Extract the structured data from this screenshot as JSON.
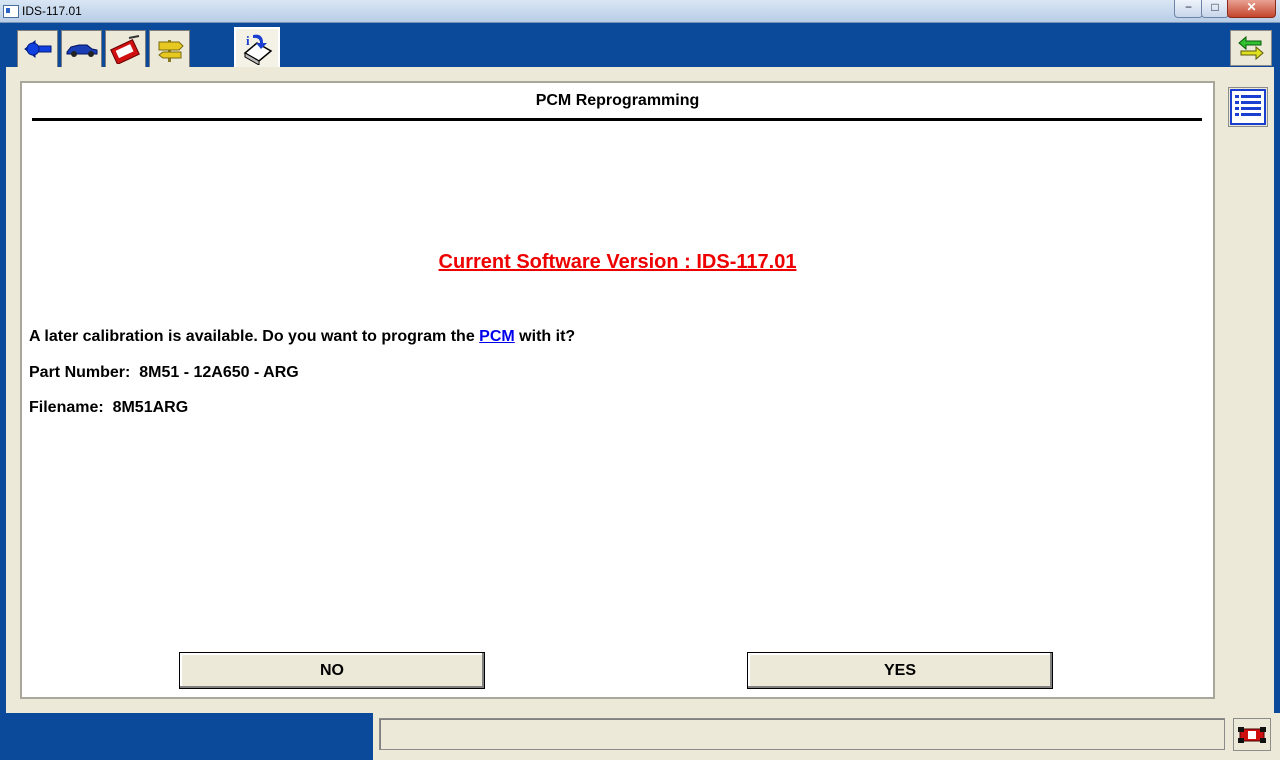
{
  "window": {
    "title": "IDS-117.01",
    "minimize_glyph": "−",
    "maximize_glyph": "□",
    "close_glyph": "✕"
  },
  "toolbar": {
    "tabs": [
      {
        "icon": "connector-icon"
      },
      {
        "icon": "vehicle-icon"
      },
      {
        "icon": "toolbox-icon"
      },
      {
        "icon": "signpost-icon"
      },
      {
        "icon": "module-programming-icon",
        "active": true
      }
    ],
    "side_button_icon": "swap-arrows-icon"
  },
  "panel": {
    "title": "PCM Reprogramming",
    "version_text": "Current Software Version : IDS-117.01",
    "question_prefix": "A later calibration is available. Do you want to program the ",
    "question_link": "PCM",
    "question_suffix": " with it?",
    "part_number": "Part Number:  8M51 - 12A650 - ARG",
    "filename": "Filename:  8M51ARG",
    "no_label": "NO",
    "yes_label": "YES",
    "list_button_icon": "list-icon"
  },
  "statusbar": {
    "text": "",
    "icon": "vehicle-status-icon"
  },
  "colors": {
    "background_blue": "#0b4a9a",
    "panel_gray": "#ece9d8",
    "version_red": "#e00000",
    "link_blue": "#0000ee"
  }
}
